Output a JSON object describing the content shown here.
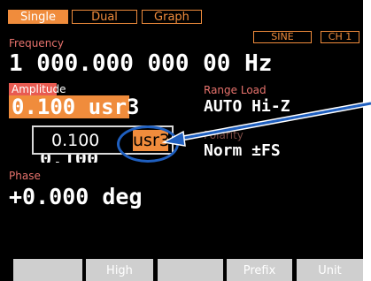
{
  "tabs": [
    {
      "label": "Single",
      "active": true
    },
    {
      "label": "Dual",
      "active": false
    },
    {
      "label": "Graph",
      "active": false
    }
  ],
  "frequency": {
    "label": "Frequency",
    "value": "1 000.000 000 00 Hz"
  },
  "waveform": "SINE",
  "channel": "CH 1",
  "amplitude": {
    "label": "Amplitude",
    "value": "0.100 usr3"
  },
  "range_load": {
    "label": "Range Load",
    "value": "AUTO Hi-Z"
  },
  "polarity": {
    "label": "Polarity",
    "value": "Norm ±FS"
  },
  "popup": {
    "number": "0.100",
    "unit": "usr3"
  },
  "phase": {
    "label": "Phase",
    "value": "+0.000 deg"
  },
  "softkeys": [
    "",
    "High",
    "",
    "Prefix",
    "Unit"
  ],
  "colors": {
    "accent": "#f08c3c",
    "label": "#e8736d",
    "highlight": "#e85b52",
    "callout": "#1f5fbf",
    "softkey": "#cfcfcf"
  }
}
